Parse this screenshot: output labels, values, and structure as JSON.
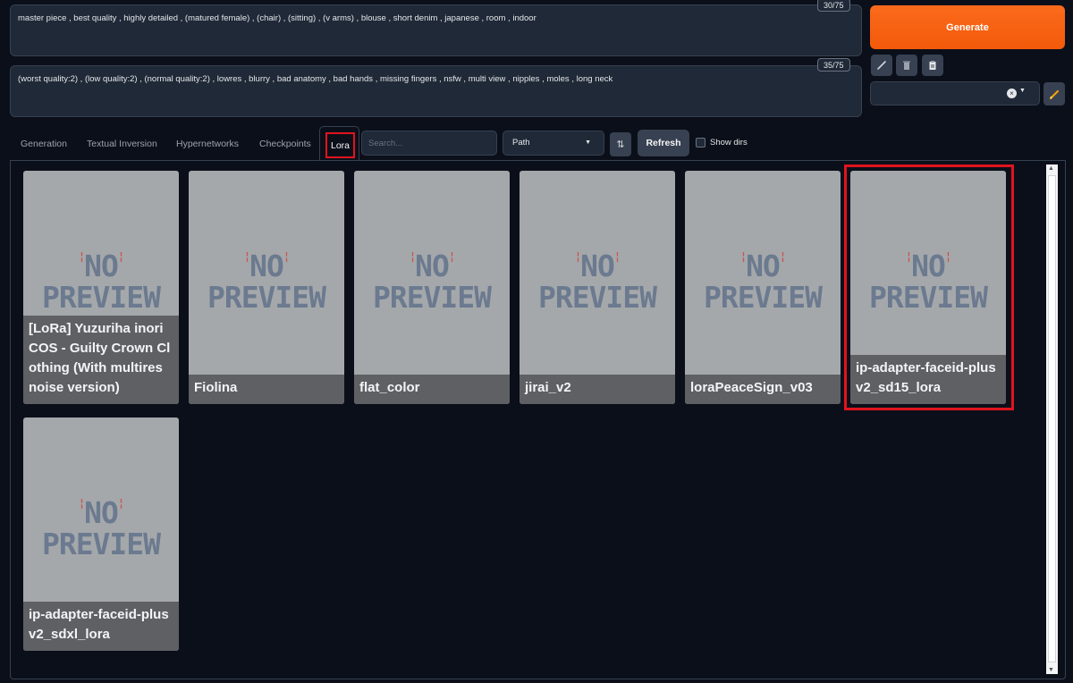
{
  "prompts": {
    "positive": "master piece , best quality , highly detailed , (matured female) , (chair) , (sitting) , (v arms) , blouse , short denim , japanese , room , indoor",
    "positive_counter": "30/75",
    "negative": "(worst quality:2) , (low quality:2) , (normal quality:2) , lowres , blurry , bad anatomy , bad hands , missing fingers , nsfw , multi view , nipples , moles , long neck",
    "negative_counter": "35/75"
  },
  "actions": {
    "generate_label": "Generate",
    "tools": [
      "pencil-icon",
      "trash-icon",
      "clipboard-icon"
    ],
    "style_clear_glyph": "×",
    "style_caret": "▼"
  },
  "tabs": [
    "Generation",
    "Textual Inversion",
    "Hypernetworks",
    "Checkpoints",
    "Lora"
  ],
  "toolbar": {
    "search_placeholder": "Search...",
    "sort_value": "Path",
    "sort_caret": "▼",
    "sort_order_glyph": "⇅",
    "refresh_label": "Refresh",
    "show_dirs_label": "Show dirs"
  },
  "cards": {
    "preview_line1": "NO",
    "preview_line2": "PREVIEW",
    "items": [
      {
        "label": "[LoRa] Yuzuriha inori COS - Guilty Crown Clothing (With multires noise version)"
      },
      {
        "label": "Fiolina"
      },
      {
        "label": "flat_color"
      },
      {
        "label": "jirai_v2"
      },
      {
        "label": "loraPeaceSign_v03"
      },
      {
        "label": "ip-adapter-faceid-plusv2_sd15_lora"
      },
      {
        "label": "ip-adapter-faceid-plusv2_sdxl_lora"
      }
    ]
  },
  "colors": {
    "accent": "#f35a0a",
    "highlight": "#e0141e",
    "background": "#0b0f19"
  }
}
